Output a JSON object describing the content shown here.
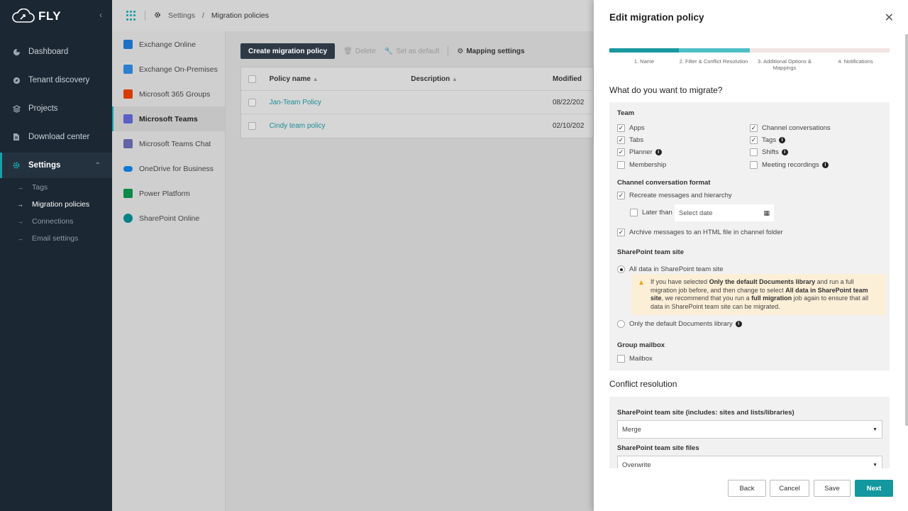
{
  "brand": {
    "logo_text": "FLY",
    "accent": "#19a0a8"
  },
  "sidebar": {
    "items": [
      {
        "label": "Dashboard",
        "icon": "pie-chart-icon"
      },
      {
        "label": "Tenant discovery",
        "icon": "compass-icon"
      },
      {
        "label": "Projects",
        "icon": "layers-icon"
      },
      {
        "label": "Download center",
        "icon": "file-icon"
      },
      {
        "label": "Settings",
        "icon": "gear-icon"
      }
    ],
    "sub_items": [
      "Tags",
      "Migration policies",
      "Connections",
      "Email settings"
    ]
  },
  "breadcrumb": {
    "root": "Settings",
    "separator": "/",
    "current": "Migration policies"
  },
  "services": [
    {
      "label": "Exchange Online",
      "color": "#1f6fc5"
    },
    {
      "label": "Exchange On-Premises",
      "color": "#2a7fd0"
    },
    {
      "label": "Microsoft 365 Groups",
      "color": "#d83b01"
    },
    {
      "label": "Microsoft Teams",
      "color": "#5b5fc7"
    },
    {
      "label": "Microsoft Teams Chat",
      "color": "#6264a7"
    },
    {
      "label": "OneDrive for Business",
      "color": "#0f78d4"
    },
    {
      "label": "Power Platform",
      "color": "#0b8a4a"
    },
    {
      "label": "SharePoint Online",
      "color": "#038387"
    }
  ],
  "toolbar": {
    "create_label": "Create migration policy",
    "delete_label": "Delete",
    "default_label": "Set as default",
    "mapping_label": "Mapping settings"
  },
  "table": {
    "headers": {
      "name": "Policy name",
      "description": "Description",
      "modified": "Modified"
    },
    "rows": [
      {
        "name": "Jan-Team Policy",
        "description": "",
        "modified": "08/22/202"
      },
      {
        "name": "Cindy team policy",
        "description": "",
        "modified": "02/10/202"
      }
    ]
  },
  "panel": {
    "title": "Edit migration policy",
    "steps": [
      "1. Name",
      "2. Filter & Conflict Resolution",
      "3. Additional Options & Mappings",
      "4. Notifications"
    ],
    "migrate_title": "What do you want to migrate?",
    "team_label": "Team",
    "team_options": {
      "apps": "Apps",
      "channel_conversations": "Channel conversations",
      "tabs": "Tabs",
      "tags": "Tags",
      "planner": "Planner",
      "shifts": "Shifts",
      "membership": "Membership",
      "meeting_recordings": "Meeting recordings"
    },
    "format_label": "Channel conversation format",
    "recreate_label": "Recreate messages and hierarchy",
    "later_than_label": "Later than",
    "date_placeholder": "Select date",
    "archive_label": "Archive messages to an HTML file in channel folder",
    "sp_site_label": "SharePoint team site",
    "sp_all_label": "All data in SharePoint team site",
    "warning": {
      "p1": "If you have selected ",
      "b1": "Only the default Documents library",
      "p2": " and run a full migration job before, and then change to select ",
      "b2": "All data in SharePoint team site",
      "p3": ", we recommend that you run a ",
      "b3": "full migration",
      "p4": " job again to ensure that all data in SharePoint team site can be migrated."
    },
    "sp_docs_label": "Only the default Documents library",
    "mailbox_group_label": "Group mailbox",
    "mailbox_label": "Mailbox",
    "conflict_title": "Conflict resolution",
    "sp_conflict_label": "SharePoint team site (includes: sites and lists/libraries)",
    "sp_conflict_value": "Merge",
    "sp_files_label": "SharePoint team site files",
    "sp_files_value": "Overwrite",
    "buttons": {
      "back": "Back",
      "cancel": "Cancel",
      "save": "Save",
      "next": "Next"
    }
  }
}
